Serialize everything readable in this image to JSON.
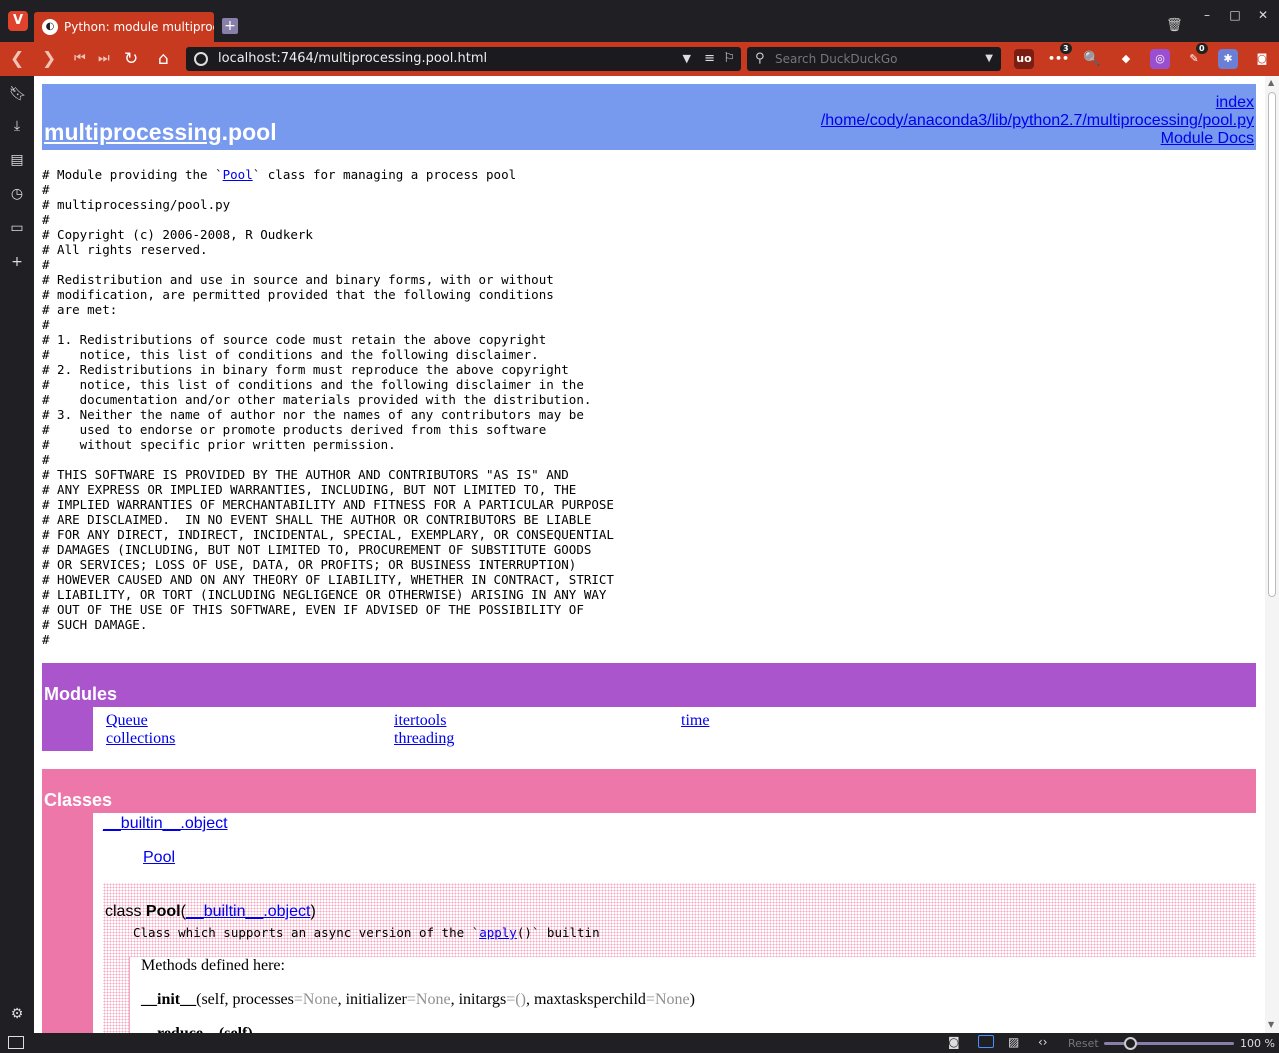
{
  "browser": {
    "tab_title": "Python: module multiproce",
    "url": "localhost:7464/multiprocessing.pool.html",
    "search_placeholder": "Search DuckDuckGo",
    "ext_badges": {
      "dots": "3",
      "feather": "0"
    },
    "zoom_reset": "Reset",
    "zoom_percent": "100 %",
    "zoom_level": 1.0
  },
  "header": {
    "module_name": "multiprocessing",
    "module_suffix": ".pool",
    "links": [
      "index",
      "/home/cody/anaconda3/lib/python2.7/multiprocessing/pool.py",
      "Module Docs"
    ]
  },
  "docstring": {
    "line1_pre": "# Module providing the `",
    "line1_link": "Pool",
    "line1_post": "` class for managing a process pool",
    "lines": [
      "#",
      "# multiprocessing/pool.py",
      "#",
      "# Copyright (c) 2006-2008, R Oudkerk",
      "# All rights reserved.",
      "#",
      "# Redistribution and use in source and binary forms, with or without",
      "# modification, are permitted provided that the following conditions",
      "# are met:",
      "#",
      "# 1. Redistributions of source code must retain the above copyright",
      "#    notice, this list of conditions and the following disclaimer.",
      "# 2. Redistributions in binary form must reproduce the above copyright",
      "#    notice, this list of conditions and the following disclaimer in the",
      "#    documentation and/or other materials provided with the distribution.",
      "# 3. Neither the name of author nor the names of any contributors may be",
      "#    used to endorse or promote products derived from this software",
      "#    without specific prior written permission.",
      "#",
      "# THIS SOFTWARE IS PROVIDED BY THE AUTHOR AND CONTRIBUTORS \"AS IS\" AND",
      "# ANY EXPRESS OR IMPLIED WARRANTIES, INCLUDING, BUT NOT LIMITED TO, THE",
      "# IMPLIED WARRANTIES OF MERCHANTABILITY AND FITNESS FOR A PARTICULAR PURPOSE",
      "# ARE DISCLAIMED.  IN NO EVENT SHALL THE AUTHOR OR CONTRIBUTORS BE LIABLE",
      "# FOR ANY DIRECT, INDIRECT, INCIDENTAL, SPECIAL, EXEMPLARY, OR CONSEQUENTIAL",
      "# DAMAGES (INCLUDING, BUT NOT LIMITED TO, PROCUREMENT OF SUBSTITUTE GOODS",
      "# OR SERVICES; LOSS OF USE, DATA, OR PROFITS; OR BUSINESS INTERRUPTION)",
      "# HOWEVER CAUSED AND ON ANY THEORY OF LIABILITY, WHETHER IN CONTRACT, STRICT",
      "# LIABILITY, OR TORT (INCLUDING NEGLIGENCE OR OTHERWISE) ARISING IN ANY WAY",
      "# OUT OF THE USE OF THIS SOFTWARE, EVEN IF ADVISED OF THE POSSIBILITY OF",
      "# SUCH DAMAGE.",
      "#"
    ]
  },
  "modules": {
    "title": "Modules",
    "col1": [
      "Queue",
      "collections"
    ],
    "col2": [
      "itertools",
      "threading"
    ],
    "col3": [
      "time"
    ]
  },
  "classes": {
    "title": "Classes",
    "tree_root": "__builtin__.object",
    "tree_child": "Pool",
    "class_keyword": "class ",
    "class_name": "Pool",
    "class_base": "__builtin__.object",
    "class_doc_pre": "Class which supports an async version of the `",
    "class_doc_link": "apply",
    "class_doc_post": "()` builtin",
    "methods_title": "Methods defined here:",
    "init_name": "__init__",
    "init_args": [
      {
        "text": "(self, processes",
        "gray": false
      },
      {
        "text": "=None",
        "gray": true
      },
      {
        "text": ", initializer",
        "gray": false
      },
      {
        "text": "=None",
        "gray": true
      },
      {
        "text": ", initargs",
        "gray": false
      },
      {
        "text": "=()",
        "gray": true
      },
      {
        "text": ", maxtasksperchild",
        "gray": false
      },
      {
        "text": "=None",
        "gray": true
      },
      {
        "text": ")",
        "gray": false
      }
    ],
    "next_method_partial": "__reduce__(self)"
  },
  "colors": {
    "header_bg": "#7799ee",
    "modules_bg": "#aa55cc",
    "classes_bg": "#ee77aa",
    "class_box_bg": "#ffc8d8",
    "default_gray": "#909090",
    "browser_accent": "#c83a1f"
  }
}
